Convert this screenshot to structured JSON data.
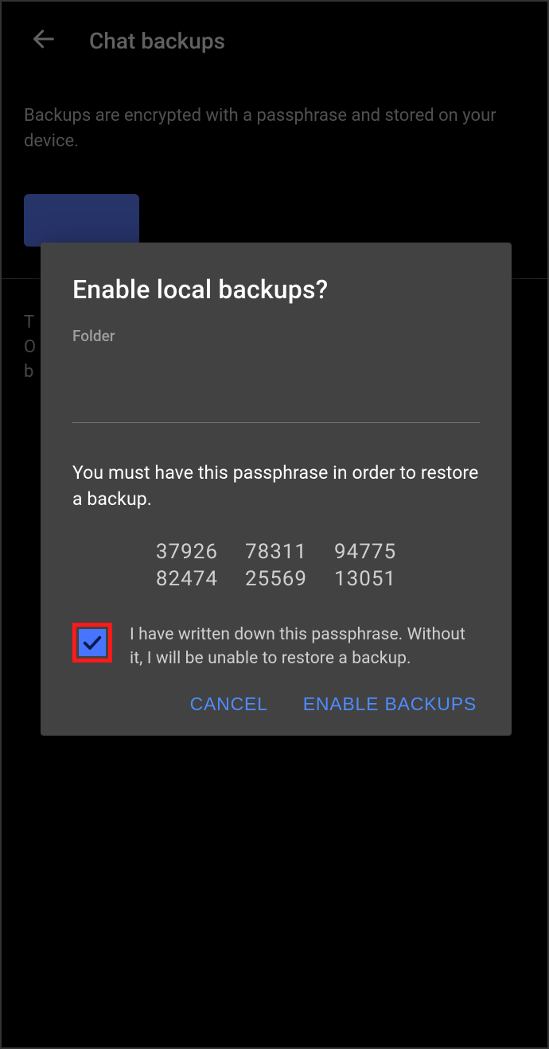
{
  "header": {
    "title": "Chat backups"
  },
  "background": {
    "description": "Backups are encrypted with a passphrase and stored on your device.",
    "truncated_lines": [
      "T",
      "O",
      "b"
    ]
  },
  "dialog": {
    "title": "Enable local backups?",
    "folder_label": "Folder",
    "folder_value": "",
    "instruction": "You must have this passphrase in order to restore a backup.",
    "passphrase": [
      "37926",
      "78311",
      "94775",
      "82474",
      "25569",
      "13051"
    ],
    "checkbox": {
      "checked": true,
      "highlighted": true,
      "label": "I have written down this passphrase. Without it, I will be unable to restore a backup."
    },
    "buttons": {
      "cancel": "CANCEL",
      "confirm": "ENABLE BACKUPS"
    }
  }
}
